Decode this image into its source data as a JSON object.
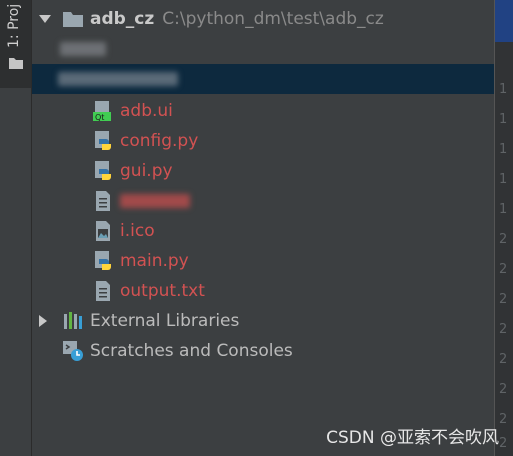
{
  "side_tab": {
    "label": "1: Proj"
  },
  "project": {
    "name": "adb_cz",
    "path": "C:\\python_dm\\test\\adb_cz"
  },
  "files": [
    {
      "name": "adb.ui",
      "icon": "qt-ui-file-icon"
    },
    {
      "name": "config.py",
      "icon": "python-file-icon"
    },
    {
      "name": "gui.py",
      "icon": "python-file-icon"
    },
    {
      "name": "",
      "icon": "text-file-icon"
    },
    {
      "name": "i.ico",
      "icon": "image-file-icon"
    },
    {
      "name": "main.py",
      "icon": "python-file-icon"
    },
    {
      "name": "output.txt",
      "icon": "text-file-icon"
    }
  ],
  "external_libraries": "External Libraries",
  "scratches": "Scratches and Consoles",
  "gutter_numbers": [
    "1",
    "1",
    "1",
    "1",
    "1",
    "2",
    "2",
    "2",
    "2",
    "2",
    "2",
    "2",
    "2",
    "2"
  ],
  "watermark": "CSDN @亚索不会吹风",
  "colors": {
    "selection": "#0d293e",
    "file_error_red": "#d25252",
    "panel": "#3c3f41"
  }
}
